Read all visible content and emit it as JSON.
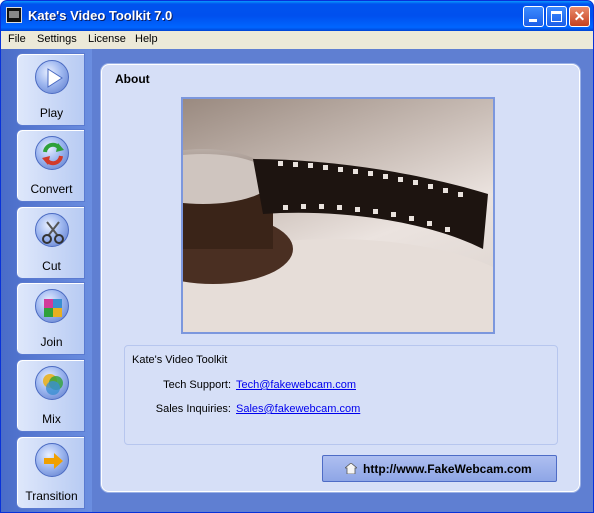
{
  "window": {
    "title": "Kate's Video Toolkit 7.0"
  },
  "menu": [
    "File",
    "Settings",
    "License",
    "Help"
  ],
  "sidebar": {
    "items": [
      {
        "label": "Play",
        "icon": "play-icon"
      },
      {
        "label": "Convert",
        "icon": "convert-icon"
      },
      {
        "label": "Cut",
        "icon": "scissors-icon"
      },
      {
        "label": "Join",
        "icon": "puzzle-icon"
      },
      {
        "label": "Mix",
        "icon": "mix-icon"
      },
      {
        "label": "Transition",
        "icon": "arrow-right-icon"
      }
    ]
  },
  "about": {
    "title": "About",
    "app_name": "Kate's Video Toolkit",
    "tech_support_label": "Tech Support:",
    "tech_support_email": "Tech@fakewebcam.com",
    "sales_label": "Sales Inquiries:",
    "sales_email": "Sales@fakewebcam.com",
    "website_button": "http://www.FakeWebcam.com"
  },
  "colors": {
    "sidebar_blue": "#5f7fd2",
    "panel_bg": "#d6dff7",
    "link": "#0000ee"
  }
}
